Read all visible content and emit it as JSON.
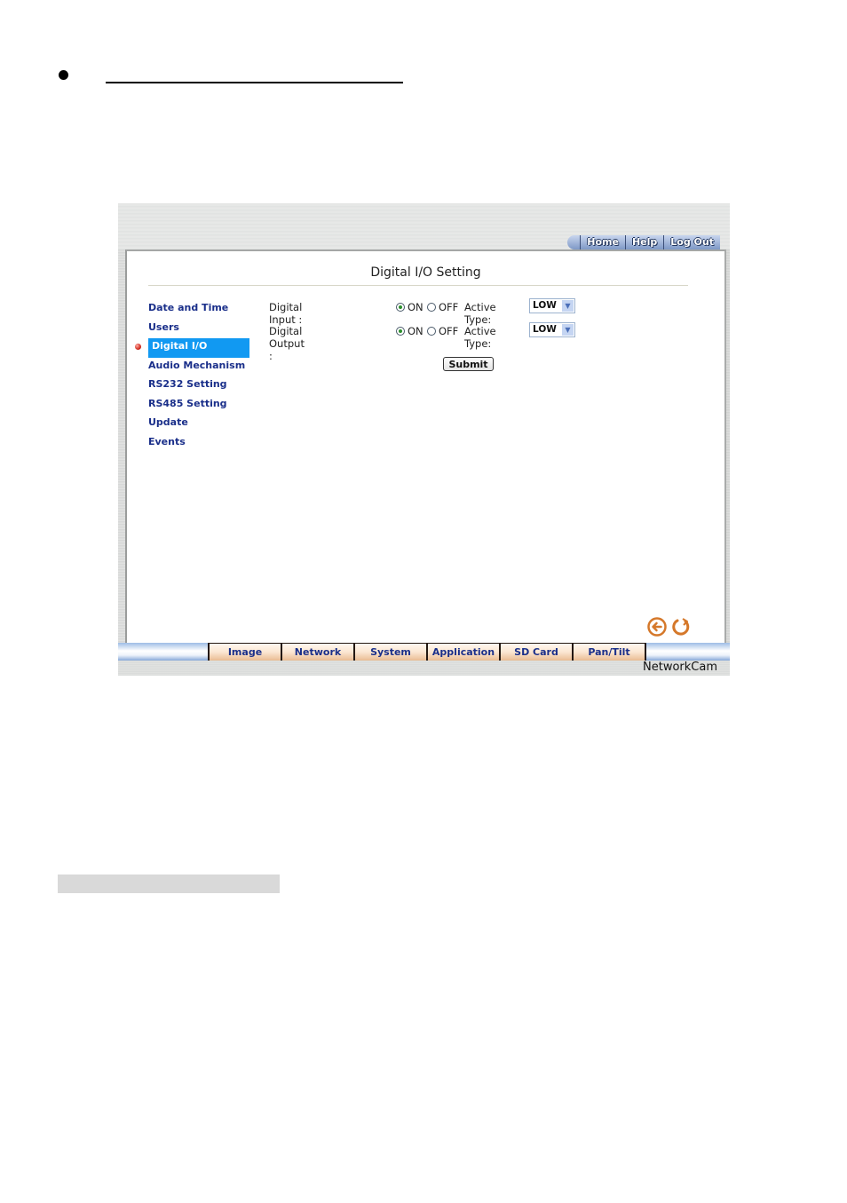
{
  "document": {
    "bullet": "•",
    "heading_text": ""
  },
  "app": {
    "brand": "NetworkCam",
    "top_nav": [
      "Home",
      "Help",
      "Log Out"
    ],
    "page_title": "Digital I/O Setting",
    "sidebar": {
      "items": [
        {
          "label": "Date and Time",
          "active": false
        },
        {
          "label": "Users",
          "active": false
        },
        {
          "label": "Digital I/O",
          "active": true
        },
        {
          "label": "Audio Mechanism",
          "active": false
        },
        {
          "label": "RS232 Setting",
          "active": false
        },
        {
          "label": "RS485 Setting",
          "active": false
        },
        {
          "label": "Update",
          "active": false
        },
        {
          "label": "Events",
          "active": false
        }
      ]
    },
    "form": {
      "rows": [
        {
          "label": "Digital Input :",
          "on_label": "ON",
          "off_label": "OFF",
          "selected": "ON",
          "active_type_label": "Active Type:",
          "active_type_value": "LOW"
        },
        {
          "label": "Digital Output :",
          "on_label": "ON",
          "off_label": "OFF",
          "selected": "ON",
          "active_type_label": "Active Type:",
          "active_type_value": "LOW"
        }
      ],
      "submit_label": "Submit"
    },
    "bottom_tabs": [
      "Image",
      "Network",
      "System",
      "Application",
      "SD Card",
      "Pan/Tilt"
    ],
    "icons": {
      "back": "back-arrow-icon",
      "refresh": "refresh-icon"
    },
    "colors": {
      "accent": "#1199f2",
      "link": "#1a2f8a",
      "icon_orange": "#d5782a"
    }
  }
}
